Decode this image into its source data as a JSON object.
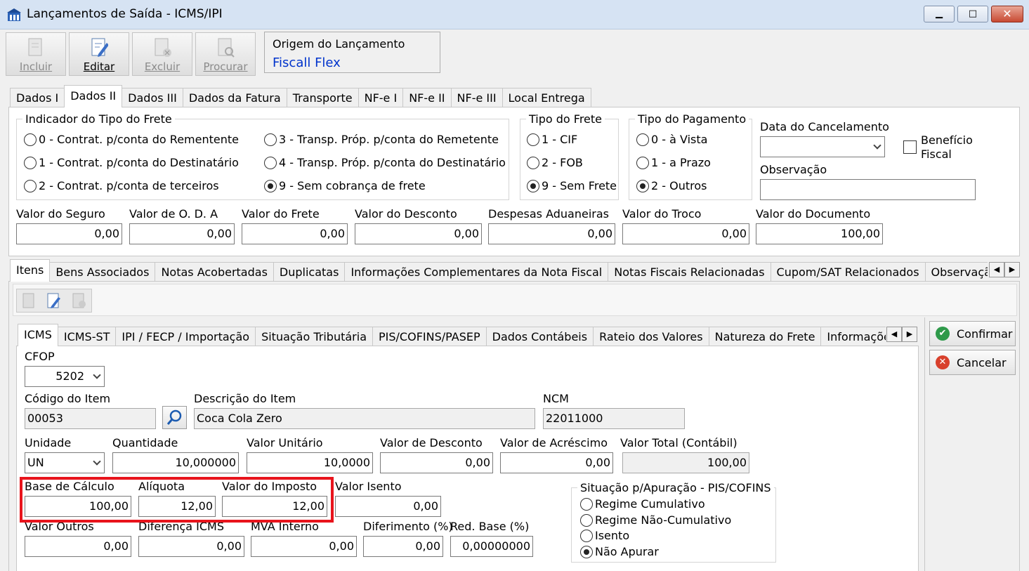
{
  "window": {
    "title": "Lançamentos de Saída - ICMS/IPI",
    "minimize": "▁",
    "maximize": "□",
    "close": "✕"
  },
  "toolbar": {
    "incluir": "Incluir",
    "editar": "Editar",
    "excluir": "Excluir",
    "procurar": "Procurar"
  },
  "origem": {
    "label": "Origem do Lançamento",
    "value": "Fiscall Flex",
    "value_color": "#0033cc"
  },
  "main_tabs": [
    "Dados I",
    "Dados II",
    "Dados III",
    "Dados da Fatura",
    "Transporte",
    "NF-e I",
    "NF-e II",
    "NF-e III",
    "Local Entrega"
  ],
  "frete": {
    "legend": "Indicador do Tipo do Frete",
    "opt0": "0 - Contrat. p/conta do Rementente",
    "opt1": "1 - Contrat. p/conta do Destinatário",
    "opt2": "2 - Contrat. p/conta de terceiros",
    "opt3": "3 - Transp. Próp. p/conta do Remetente",
    "opt4": "4 - Transp. Próp. p/conta do Destinatário",
    "opt9": "9 - Sem cobrança de frete",
    "selected": "9"
  },
  "tipo_frete": {
    "legend": "Tipo do Frete",
    "opt1": "1 - CIF",
    "opt2": "2 - FOB",
    "opt9": "9 - Sem Frete",
    "selected": "9"
  },
  "tipo_pagamento": {
    "legend": "Tipo do Pagamento",
    "opt0": "0 - à Vista",
    "opt1": "1 - a Prazo",
    "opt2": "2 - Outros",
    "selected": "2"
  },
  "data_cancelamento": {
    "label": "Data do Cancelamento",
    "value": ""
  },
  "beneficio_fiscal": {
    "label1": "Benefício",
    "label2": "Fiscal",
    "checked": false
  },
  "observacao": {
    "label": "Observação",
    "value": ""
  },
  "valores": {
    "seguro_label": "Valor do Seguro",
    "seguro": "0,00",
    "oda_label": "Valor de O. D. A",
    "oda": "0,00",
    "frete_label": "Valor do Frete",
    "frete": "0,00",
    "desconto_label": "Valor do Desconto",
    "desconto": "0,00",
    "aduaneiras_label": "Despesas Aduaneiras",
    "aduaneiras": "0,00",
    "troco_label": "Valor do Troco",
    "troco": "0,00",
    "documento_label": "Valor do Documento",
    "documento": "100,00"
  },
  "sub_tabs": [
    "Itens",
    "Bens Associados",
    "Notas Acobertadas",
    "Duplicatas",
    "Informações Complementares da Nota Fiscal",
    "Notas Fiscais Relacionadas",
    "Cupom/SAT Relacionados",
    "Observação d"
  ],
  "item_tabs": [
    "ICMS",
    "ICMS-ST",
    "IPI / FECP / Importação",
    "Situação Tributária",
    "PIS/COFINS/PASEP",
    "Dados Contábeis",
    "Rateio dos Valores",
    "Natureza do Frete",
    "Informações"
  ],
  "item": {
    "cfop_label": "CFOP",
    "cfop": "5202",
    "codigo_label": "Código do Item",
    "codigo": "00053",
    "descricao_label": "Descrição do Item",
    "descricao": "Coca Cola Zero",
    "ncm_label": "NCM",
    "ncm": "22011000",
    "unidade_label": "Unidade",
    "unidade": "UN",
    "quantidade_label": "Quantidade",
    "quantidade": "10,000000",
    "valor_unitario_label": "Valor Unitário",
    "valor_unitario": "10,0000",
    "valor_desconto_label": "Valor de Desconto",
    "valor_desconto": "0,00",
    "valor_acrescimo_label": "Valor de Acréscimo",
    "valor_acrescimo": "0,00",
    "valor_total_label": "Valor Total (Contábil)",
    "valor_total": "100,00",
    "base_calculo_label": "Base de Cálculo",
    "base_calculo": "100,00",
    "aliquota_label": "Alíquota",
    "aliquota": "12,00",
    "valor_imposto_label": "Valor do Imposto",
    "valor_imposto": "12,00",
    "valor_isento_label": "Valor Isento",
    "valor_isento": "0,00",
    "valor_outros_label": "Valor Outros",
    "valor_outros": "0,00",
    "diferenca_icms_label": "Diferença ICMS",
    "diferenca_icms": "0,00",
    "mva_label": "MVA Interno",
    "mva": "0,00",
    "diferimento_label": "Diferimento (%)",
    "diferimento": "0,00",
    "red_base_label": "Red. Base (%)",
    "red_base": "0,00000000"
  },
  "apuracao": {
    "legend": "Situação p/Apuração - PIS/COFINS",
    "opt1": "Regime Cumulativo",
    "opt2": "Regime Não-Cumulativo",
    "opt3": "Isento",
    "opt4": "Não Apurar",
    "selected": "Não Apurar"
  },
  "actions": {
    "confirmar": "Confirmar",
    "cancelar": "Cancelar",
    "confirm_color": "#2e9a4a",
    "cancel_color": "#d8402c"
  },
  "highlight_color": "#e8141c"
}
